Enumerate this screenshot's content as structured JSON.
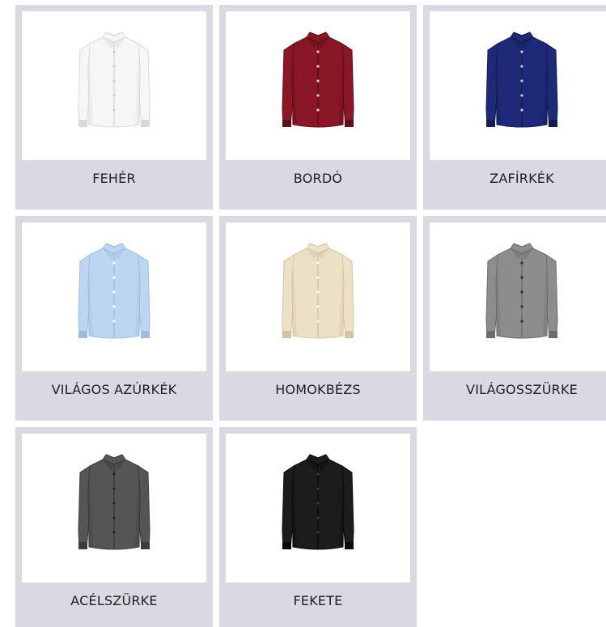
{
  "products": [
    {
      "label": "FEHÉR",
      "color": "#f6f6f4",
      "shade": "#d9d9d6",
      "button": "#cfcfcb"
    },
    {
      "label": "BORDÓ",
      "color": "#8a1726",
      "shade": "#5c0f18",
      "button": "#d9cfcf"
    },
    {
      "label": "ZAFÍRKÉK",
      "color": "#1e2a78",
      "shade": "#141c52",
      "button": "#c8cce0"
    },
    {
      "label": "VILÁGOS AZÚRKÉK",
      "color": "#bcd6f2",
      "shade": "#9dbde0",
      "button": "#ffffff"
    },
    {
      "label": "HOMOKBÉZS",
      "color": "#ece0c6",
      "shade": "#d4c4a2",
      "button": "#ffffff"
    },
    {
      "label": "VILÁGOSSZÜRKE",
      "color": "#8c8d8c",
      "shade": "#6c6d6c",
      "button": "#2a2a2a"
    },
    {
      "label": "ACÉLSZÜRKE",
      "color": "#545556",
      "shade": "#3a3b3c",
      "button": "#222222"
    },
    {
      "label": "FEKETE",
      "color": "#1c1c1c",
      "shade": "#0a0a0a",
      "button": "#3a3a3a"
    }
  ]
}
